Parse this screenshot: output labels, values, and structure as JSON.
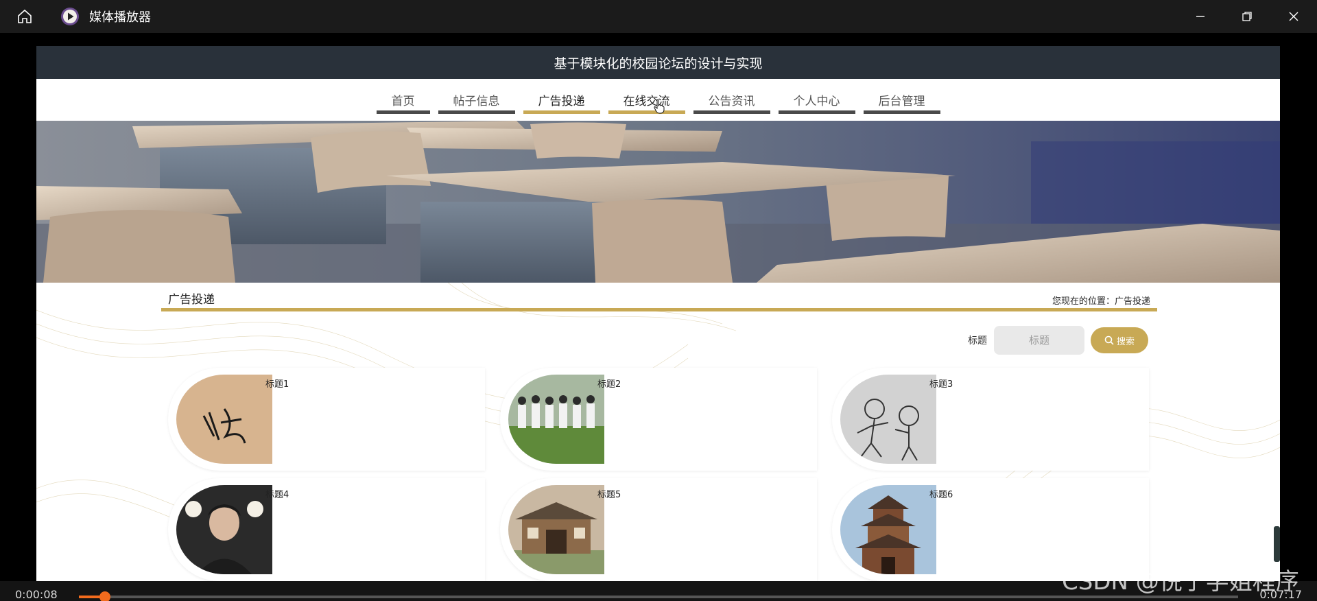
{
  "player": {
    "title": "媒体播放器",
    "current_time": "0:00:08",
    "duration": "0:07:17",
    "progress": 0.018,
    "accent": "#f26b1d"
  },
  "site": {
    "title": "基于模块化的校园论坛的设计与实现",
    "accent": "#c8a955",
    "nav": [
      {
        "label": "首页"
      },
      {
        "label": "帖子信息"
      },
      {
        "label": "广告投递"
      },
      {
        "label": "在线交流"
      },
      {
        "label": "公告资讯"
      },
      {
        "label": "个人中心"
      },
      {
        "label": "后台管理"
      }
    ],
    "active_nav": "广告投递"
  },
  "section": {
    "title": "广告投递",
    "breadcrumb": "您现在的位置：广告投递"
  },
  "search": {
    "label": "标题",
    "placeholder": "标题",
    "button": "搜索"
  },
  "cards": [
    {
      "title": "标题1",
      "image": "signature-photo"
    },
    {
      "title": "标题2",
      "image": "students-field-photo"
    },
    {
      "title": "标题3",
      "image": "cartoon-sketch"
    },
    {
      "title": "标题4",
      "image": "portrait-photo"
    },
    {
      "title": "标题5",
      "image": "old-building-photo"
    },
    {
      "title": "标题6",
      "image": "pagoda-photo"
    }
  ],
  "watermark": "CSDN @悦宁学姐程序"
}
